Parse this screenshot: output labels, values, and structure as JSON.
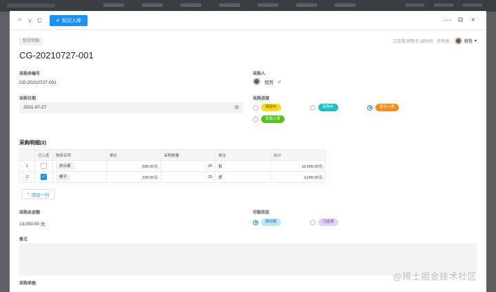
{
  "header": {
    "primary_button": "标记入库",
    "nav_back": "^",
    "nav_forward": "v",
    "refresh": "C",
    "more": "···",
    "expand": "⧉",
    "close": "×"
  },
  "record": {
    "type_tag": "物流明细",
    "meta_text": "工万装 刷新于 18时间",
    "owner_label": "所有者:",
    "owner_name": "程哲",
    "title": "CG-20210727-001"
  },
  "fields": {
    "order_no_label": "采购单编号",
    "order_no_value": "CG-20210727-001",
    "buyer_label": "采购人",
    "buyer_name": "程哲",
    "date_label": "采购日期",
    "date_value": "2021-07-27",
    "progress_label": "采购进度",
    "progress_options": [
      {
        "label": "待提中",
        "selected": false,
        "bg": "#fadb14",
        "color": "#5c4a00"
      },
      {
        "label": "采购中",
        "selected": false,
        "bg": "#13c2c2",
        "color": "#ffffff"
      },
      {
        "label": "部分入库",
        "selected": true,
        "bg": "#fa8c16",
        "color": "#ffffff"
      },
      {
        "label": "全部入库",
        "selected": false,
        "bg": "#52c41a",
        "color": "#ffffff"
      }
    ]
  },
  "detail": {
    "title": "采购明细(2)",
    "columns": [
      "",
      "已入库",
      "物资名称",
      "单价",
      "采购数量",
      "单位",
      "合计"
    ],
    "rows": [
      {
        "index": "1",
        "received": false,
        "name": "办公桌",
        "price": "500.00元",
        "qty": "20",
        "unit": "张",
        "total": "10,000.00元"
      },
      {
        "index": "2",
        "received": true,
        "name": "椅子",
        "price": "200.00元",
        "qty": "15",
        "unit": "把",
        "total": "3,000.00元"
      }
    ],
    "add_row": "添加一行"
  },
  "summary": {
    "amount_label": "采购总金额",
    "amount_value": "13,000.00 元",
    "payment_label": "付款状态",
    "payment_options": [
      {
        "label": "待付款",
        "selected": true,
        "bg": "#bae7ff",
        "color": "#1d5b8f"
      },
      {
        "label": "已结清",
        "selected": false,
        "bg": "#e3d4f5",
        "color": "#6b3fa0"
      }
    ],
    "remark_label": "备注",
    "receipt_label": "采购单据"
  },
  "watermark": "@稀土掘金技术社区"
}
